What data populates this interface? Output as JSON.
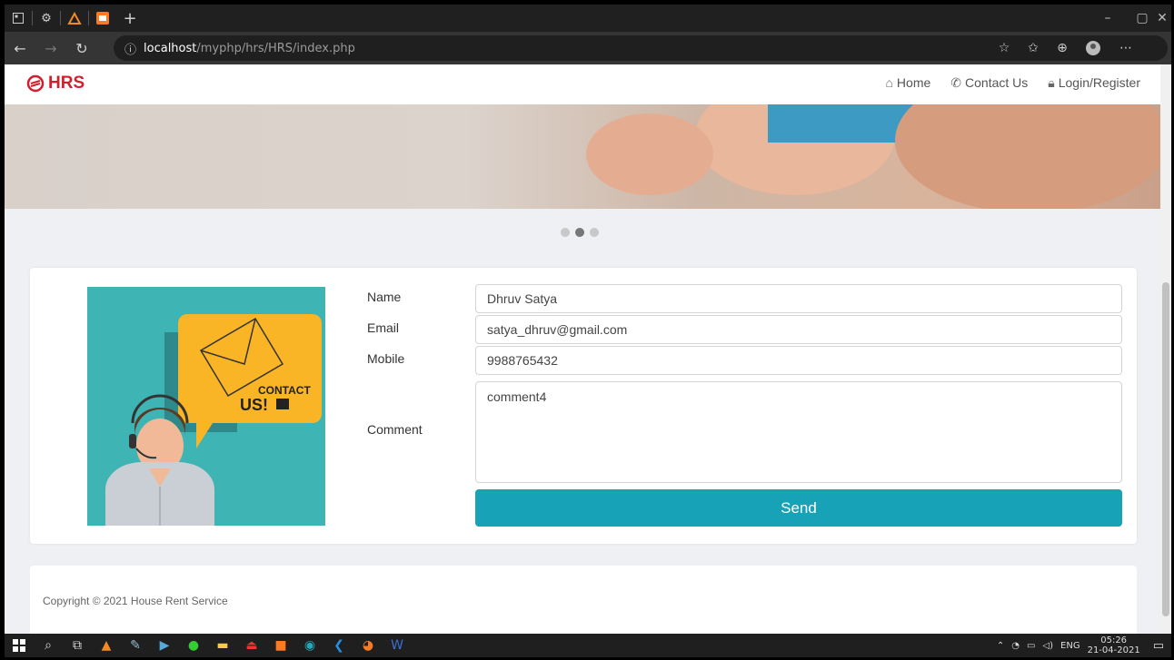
{
  "browser": {
    "url_host": "localhost",
    "url_path": "/myphp/hrs/HRS/index.php"
  },
  "navbar": {
    "brand": "HRS",
    "links": [
      {
        "label": "Home",
        "icon": "home-icon"
      },
      {
        "label": "Contact Us",
        "icon": "phone-icon"
      },
      {
        "label": "Login/Register",
        "icon": "lock-icon"
      }
    ]
  },
  "carousel": {
    "slides": 3,
    "active_index": 1
  },
  "illustration": {
    "text_line1": "CONTACT",
    "text_line2": "US!"
  },
  "form": {
    "name_label": "Name",
    "name_value": "Dhruv Satya",
    "email_label": "Email",
    "email_value": "satya_dhruv@gmail.com",
    "mobile_label": "Mobile",
    "mobile_value": "9988765432",
    "comment_label": "Comment",
    "comment_value": "comment4",
    "send_label": "Send"
  },
  "footer": {
    "copyright": "Copyright © 2021 House Rent Service"
  },
  "taskbar": {
    "lang": "ENG",
    "time": "05:26",
    "date": "21-04-2021"
  },
  "colors": {
    "brand": "#d0202d",
    "send_button": "#17a2b8",
    "illustration_bg": "#3fb4b4"
  }
}
